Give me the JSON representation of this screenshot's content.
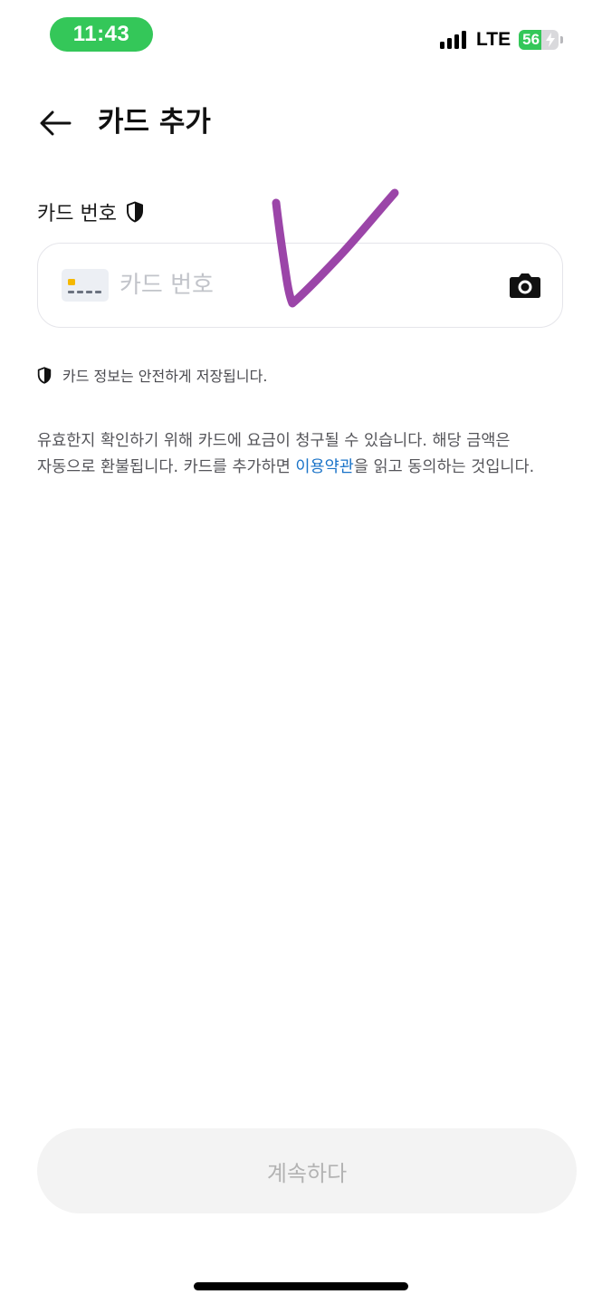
{
  "status_bar": {
    "time": "11:43",
    "network": "LTE",
    "battery_level": "56",
    "battery_percent": 56
  },
  "header": {
    "title": "카드 추가"
  },
  "card_field": {
    "label": "카드 번호",
    "placeholder": "카드 번호",
    "value": ""
  },
  "secure_note": "카드 정보는 안전하게 저장됩니다.",
  "disclaimer": {
    "text_before": "유효한지 확인하기 위해 카드에 요금이 청구될 수 있습니다. 해당 금액은 자동으로 환불됩니다. 카드를 추가하면 ",
    "link": "이용약관",
    "text_after": "을 읽고 동의하는 것입니다."
  },
  "continue_button": {
    "label": "계속하다"
  },
  "icons": {
    "back": "arrow-left-icon",
    "shield": "shield-icon",
    "card": "credit-card-icon",
    "camera": "camera-icon",
    "signal": "signal-bars-icon",
    "battery": "battery-charging-icon"
  },
  "colors": {
    "time_pill": "#34c759",
    "battery_fill": "#34c759",
    "link": "#1a73c8",
    "check_mark": "#9b45a8",
    "button_bg": "#f3f3f3",
    "button_text": "#b3b3b3"
  }
}
